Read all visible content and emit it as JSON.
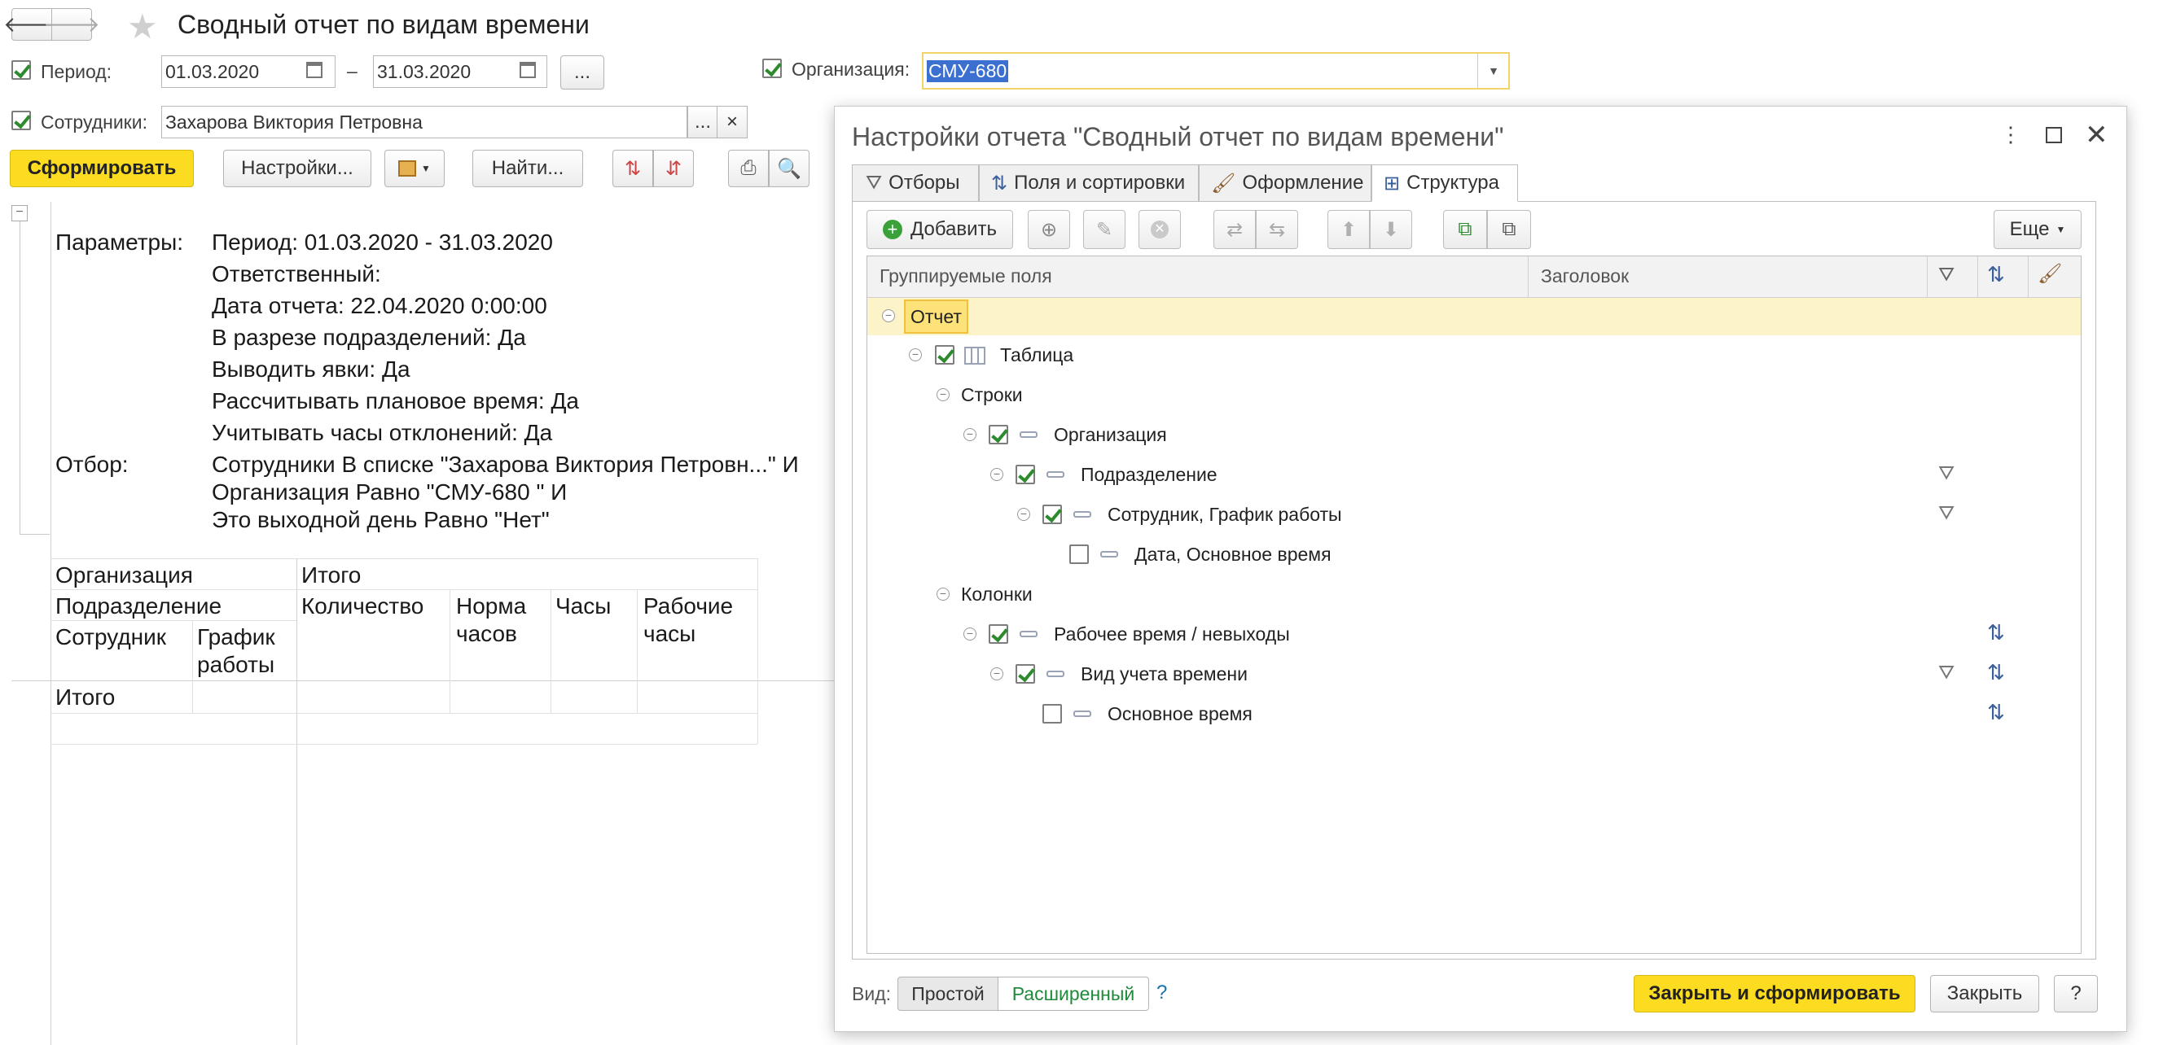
{
  "window": {
    "title": "Сводный отчет по видам времени"
  },
  "filters": {
    "period_label": "Период:",
    "period_from": "01.03.2020",
    "period_dash": "–",
    "period_to": "31.03.2020",
    "period_more": "...",
    "org_label": "Организация:",
    "org_value": "СМУ-680",
    "emp_label": "Сотрудники:",
    "emp_value": "Захарова Виктория Петровна",
    "emp_more": "...",
    "emp_clear": "×"
  },
  "toolbar": {
    "generate": "Сформировать",
    "settings": "Настройки...",
    "find": "Найти..."
  },
  "report": {
    "params_label": "Параметры:",
    "params": [
      "Период: 01.03.2020 - 31.03.2020",
      "Ответственный:",
      "Дата отчета: 22.04.2020 0:00:00",
      "В разрезе подразделений: Да",
      "Выводить явки: Да",
      "Рассчитывать плановое время: Да",
      "Учитывать часы отклонений: Да"
    ],
    "filter_label": "Отбор:",
    "filters": [
      "Сотрудники В списке \"Захарова Виктория Петровн...\" И",
      "Организация Равно \"СМУ-680 \" И",
      "Это выходной день Равно \"Нет\""
    ],
    "table": {
      "org": "Организация",
      "total_hdr": "Итого",
      "dept": "Подразделение",
      "qty": "Количество",
      "norm": "Норма часов",
      "hours": "Часы",
      "work_hours": "Рабочие часы",
      "employee": "Сотрудник",
      "schedule": "График работы",
      "total_row": "Итого"
    }
  },
  "dialog": {
    "title": "Настройки отчета \"Сводный отчет по видам времени\"",
    "tabs": [
      "Отборы",
      "Поля и сортировки",
      "Оформление",
      "Структура"
    ],
    "add": "Добавить",
    "more": "Еще",
    "columns": {
      "fields": "Группируемые поля",
      "header": "Заголовок"
    },
    "tree": {
      "report": "Отчет",
      "table": "Таблица",
      "rows": "Строки",
      "org": "Организация",
      "dept": "Подразделение",
      "emp": "Сотрудник, График работы",
      "date": "Дата, Основное время",
      "cols": "Колонки",
      "worktime": "Рабочее время / невыходы",
      "timetype": "Вид учета времени",
      "maintime": "Основное время"
    },
    "footer": {
      "view_label": "Вид:",
      "simple": "Простой",
      "extended": "Расширенный",
      "help_q": "?",
      "close_generate": "Закрыть и сформировать",
      "close": "Закрыть",
      "help": "?"
    }
  },
  "colors": {
    "accent": "#fcdc20",
    "selected_row": "#fdf3c8",
    "check": "#2d8a2d",
    "link": "#1a73a8"
  }
}
